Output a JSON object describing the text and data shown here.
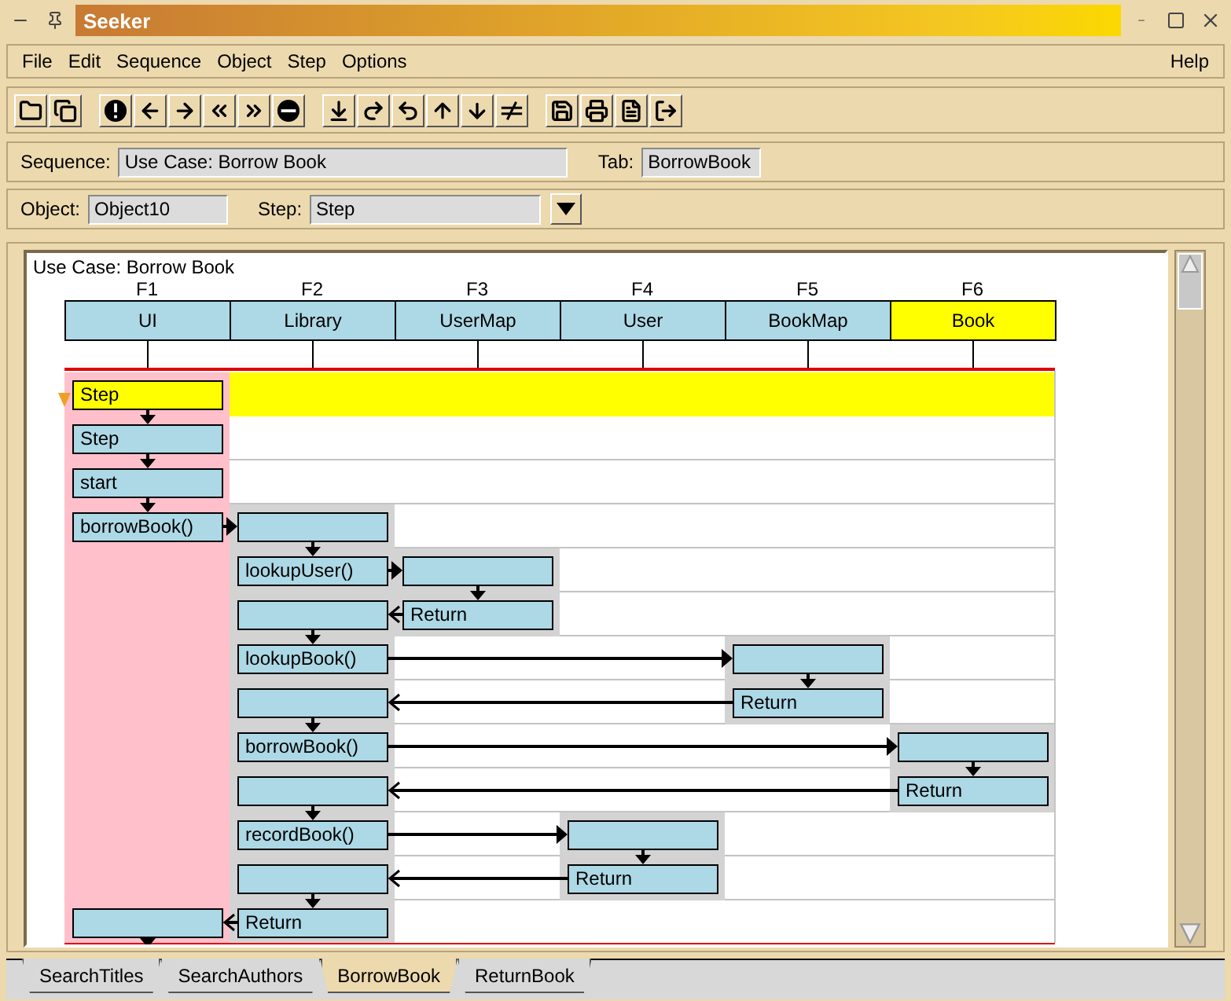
{
  "window": {
    "title": "Seeker"
  },
  "menu": [
    {
      "label": "File"
    },
    {
      "label": "Edit"
    },
    {
      "label": "Sequence"
    },
    {
      "label": "Object"
    },
    {
      "label": "Step"
    },
    {
      "label": "Options"
    }
  ],
  "help_menu": {
    "label": "Help"
  },
  "sequence_bar": {
    "sequence_label": "Sequence:",
    "sequence_value": "Use Case: Borrow Book",
    "tab_label": "Tab:",
    "tab_value": "BorrowBook"
  },
  "object_bar": {
    "object_label": "Object:",
    "object_value": "Object10",
    "step_label": "Step:",
    "step_value": "Step"
  },
  "diagram": {
    "title": "Use Case: Borrow Book",
    "objects": [
      {
        "frame": "F1",
        "name": "UI",
        "selected": false
      },
      {
        "frame": "F2",
        "name": "Library",
        "selected": false
      },
      {
        "frame": "F3",
        "name": "UserMap",
        "selected": false
      },
      {
        "frame": "F4",
        "name": "User",
        "selected": false
      },
      {
        "frame": "F5",
        "name": "BookMap",
        "selected": false
      },
      {
        "frame": "F6",
        "name": "Book",
        "selected": true
      }
    ],
    "rows": [
      {
        "selected": true,
        "lanes": [
          {
            "kind": "box",
            "label": "Step"
          },
          {
            "kind": "empty"
          },
          {
            "kind": "empty"
          },
          {
            "kind": "empty"
          },
          {
            "kind": "empty"
          },
          {
            "kind": "empty"
          }
        ]
      },
      {
        "selected": false,
        "lanes": [
          {
            "kind": "box",
            "label": "Step"
          },
          {
            "kind": "empty"
          },
          {
            "kind": "empty"
          },
          {
            "kind": "empty"
          },
          {
            "kind": "empty"
          },
          {
            "kind": "empty"
          }
        ]
      },
      {
        "selected": false,
        "lanes": [
          {
            "kind": "box",
            "label": "start"
          },
          {
            "kind": "empty"
          },
          {
            "kind": "empty"
          },
          {
            "kind": "empty"
          },
          {
            "kind": "empty"
          },
          {
            "kind": "empty"
          }
        ]
      },
      {
        "selected": false,
        "kind": "call",
        "lanes": [
          {
            "kind": "box",
            "label": "borrowBook()"
          },
          {
            "kind": "box"
          },
          {
            "kind": "empty"
          },
          {
            "kind": "empty"
          },
          {
            "kind": "empty"
          },
          {
            "kind": "empty"
          }
        ]
      },
      {
        "selected": false,
        "kind": "call",
        "lanes": [
          {
            "kind": "active"
          },
          {
            "kind": "box",
            "label": "lookupUser()"
          },
          {
            "kind": "box"
          },
          {
            "kind": "empty"
          },
          {
            "kind": "empty"
          },
          {
            "kind": "empty"
          }
        ]
      },
      {
        "selected": false,
        "kind": "return",
        "lanes": [
          {
            "kind": "active"
          },
          {
            "kind": "box"
          },
          {
            "kind": "box",
            "label": "Return"
          },
          {
            "kind": "empty"
          },
          {
            "kind": "empty"
          },
          {
            "kind": "empty"
          }
        ]
      },
      {
        "selected": false,
        "kind": "call",
        "lanes": [
          {
            "kind": "active"
          },
          {
            "kind": "box",
            "label": "lookupBook()"
          },
          {
            "kind": "empty"
          },
          {
            "kind": "empty"
          },
          {
            "kind": "box"
          },
          {
            "kind": "empty"
          }
        ]
      },
      {
        "selected": false,
        "kind": "return",
        "lanes": [
          {
            "kind": "active"
          },
          {
            "kind": "box"
          },
          {
            "kind": "empty"
          },
          {
            "kind": "empty"
          },
          {
            "kind": "box",
            "label": "Return"
          },
          {
            "kind": "empty"
          }
        ]
      },
      {
        "selected": false,
        "kind": "call",
        "lanes": [
          {
            "kind": "active"
          },
          {
            "kind": "box",
            "label": "borrowBook()"
          },
          {
            "kind": "empty"
          },
          {
            "kind": "empty"
          },
          {
            "kind": "empty"
          },
          {
            "kind": "box"
          }
        ]
      },
      {
        "selected": false,
        "kind": "return",
        "lanes": [
          {
            "kind": "active"
          },
          {
            "kind": "box"
          },
          {
            "kind": "empty"
          },
          {
            "kind": "empty"
          },
          {
            "kind": "empty"
          },
          {
            "kind": "box",
            "label": "Return"
          }
        ]
      },
      {
        "selected": false,
        "kind": "call",
        "lanes": [
          {
            "kind": "active"
          },
          {
            "kind": "box",
            "label": "recordBook()"
          },
          {
            "kind": "empty"
          },
          {
            "kind": "box"
          },
          {
            "kind": "empty"
          },
          {
            "kind": "empty"
          }
        ]
      },
      {
        "selected": false,
        "kind": "return",
        "lanes": [
          {
            "kind": "active"
          },
          {
            "kind": "box"
          },
          {
            "kind": "empty"
          },
          {
            "kind": "box",
            "label": "Return"
          },
          {
            "kind": "empty"
          },
          {
            "kind": "empty"
          }
        ]
      },
      {
        "selected": false,
        "kind": "return",
        "lanes": [
          {
            "kind": "box"
          },
          {
            "kind": "box",
            "label": "Return"
          },
          {
            "kind": "empty"
          },
          {
            "kind": "empty"
          },
          {
            "kind": "empty"
          },
          {
            "kind": "empty"
          }
        ]
      }
    ]
  },
  "tabs": [
    {
      "label": "SearchTitles",
      "selected": false
    },
    {
      "label": "SearchAuthors",
      "selected": false
    },
    {
      "label": "BorrowBook",
      "selected": true
    },
    {
      "label": "ReturnBook",
      "selected": false
    }
  ]
}
